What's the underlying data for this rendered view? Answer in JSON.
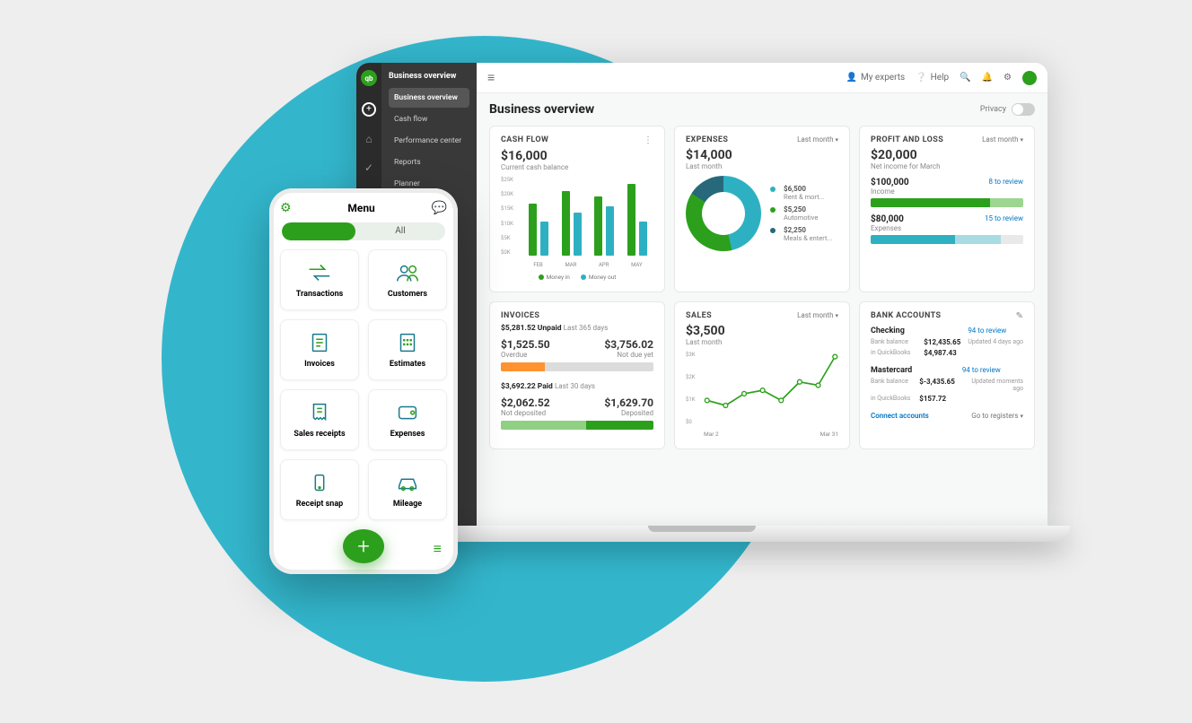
{
  "circle_color": "#33b6cc",
  "brand_green": "#2ca01c",
  "brand_teal": "#2db1c2",
  "brand_dkteal": "#27697a",
  "orange": "#ff9331",
  "dk_green": "#0f8a2f",
  "desktop": {
    "topbar": {
      "my_experts": "My experts",
      "help": "Help",
      "menu_icon": "≡"
    },
    "nav": {
      "header": "Business overview",
      "items": [
        "Business overview",
        "Cash flow",
        "Performance center",
        "Reports",
        "Planner"
      ]
    },
    "page_title": "Business overview",
    "privacy_label": "Privacy",
    "cash_flow": {
      "title": "CASH FLOW",
      "amount": "$16,000",
      "sub": "Current cash balance",
      "y_ticks": [
        "$25K",
        "$20K",
        "$15K",
        "$10K",
        "$5K",
        "$0K"
      ],
      "x_labels": [
        "FEB",
        "MAR",
        "APR",
        "MAY"
      ],
      "legend_in": "Money in",
      "legend_out": "Money out"
    },
    "expenses": {
      "title": "EXPENSES",
      "period": "Last month",
      "amount": "$14,000",
      "sub": "Last month",
      "slices": [
        {
          "amount": "$6,500",
          "label": "Rent & mort...",
          "color": "#2db1c2"
        },
        {
          "amount": "$5,250",
          "label": "Automotive",
          "color": "#2ca01c"
        },
        {
          "amount": "$2,250",
          "label": "Meals & entert...",
          "color": "#27697a"
        }
      ]
    },
    "profit_loss": {
      "title": "PROFIT AND LOSS",
      "period": "Last month",
      "amount": "$20,000",
      "sub": "Net income for March",
      "income_amt": "$100,000",
      "income_lbl": "Income",
      "income_review": "8 to review",
      "expense_amt": "$80,000",
      "expense_lbl": "Expenses",
      "expense_review": "15 to review"
    },
    "invoices": {
      "title": "INVOICES",
      "unpaid_total": "$5,281.52 Unpaid",
      "unpaid_range": "Last 365 days",
      "overdue_amt": "$1,525.50",
      "overdue_lbl": "Overdue",
      "notdue_amt": "$3,756.02",
      "notdue_lbl": "Not due yet",
      "paid_total": "$3,692.22 Paid",
      "paid_range": "Last 30 days",
      "notdep_amt": "$2,062.52",
      "notdep_lbl": "Not deposited",
      "dep_amt": "$1,629.70",
      "dep_lbl": "Deposited"
    },
    "sales": {
      "title": "SALES",
      "period": "Last month",
      "amount": "$3,500",
      "sub": "Last month",
      "y_ticks": [
        "$3K",
        "$2K",
        "$1K",
        "$0"
      ],
      "x_start": "Mar 2",
      "x_end": "Mar 31"
    },
    "bank": {
      "title": "BANK ACCOUNTS",
      "accounts": [
        {
          "name": "Checking",
          "review": "94 to review",
          "bank_bal_lbl": "Bank balance",
          "bank_bal": "$12,435.65",
          "qb_lbl": "in QuickBooks",
          "qb_bal": "$4,987.43",
          "updated": "Updated 4 days ago"
        },
        {
          "name": "Mastercard",
          "review": "94 to review",
          "bank_bal_lbl": "Bank balance",
          "bank_bal": "$-3,435.65",
          "qb_lbl": "in QuickBooks",
          "qb_bal": "$157.72",
          "updated": "Updated moments ago"
        }
      ],
      "connect": "Connect accounts",
      "registers": "Go to registers"
    }
  },
  "phone": {
    "title": "Menu",
    "chip_all": "All",
    "tiles": [
      {
        "label": "Transactions"
      },
      {
        "label": "Customers"
      },
      {
        "label": "Invoices"
      },
      {
        "label": "Estimates"
      },
      {
        "label": "Sales receipts"
      },
      {
        "label": "Expenses"
      },
      {
        "label": "Receipt snap"
      },
      {
        "label": "Mileage"
      }
    ]
  },
  "chart_data": [
    {
      "type": "bar",
      "title": "CASH FLOW",
      "categories": [
        "FEB",
        "MAR",
        "APR",
        "MAY"
      ],
      "series": [
        {
          "name": "Money in",
          "values": [
            17000,
            21000,
            19000,
            23000
          ]
        },
        {
          "name": "Money out",
          "values": [
            11000,
            14000,
            16000,
            11000
          ]
        }
      ],
      "ylim": [
        0,
        25000
      ],
      "ylabel": "",
      "xlabel": ""
    },
    {
      "type": "pie",
      "title": "EXPENSES Last month",
      "categories": [
        "Rent & mortgage",
        "Automotive",
        "Meals & entertainment"
      ],
      "values": [
        6500,
        5250,
        2250
      ]
    },
    {
      "type": "bar",
      "title": "PROFIT AND LOSS – progress",
      "categories": [
        "Income",
        "Expenses"
      ],
      "values": [
        100000,
        80000
      ],
      "annotations": {
        "Income": "8 to review",
        "Expenses": "15 to review"
      }
    },
    {
      "type": "bar",
      "title": "INVOICES Unpaid $5,281.52",
      "categories": [
        "Overdue",
        "Not due yet"
      ],
      "values": [
        1525.5,
        3756.02
      ]
    },
    {
      "type": "bar",
      "title": "INVOICES Paid $3,692.22",
      "categories": [
        "Not deposited",
        "Deposited"
      ],
      "values": [
        2062.52,
        1629.7
      ]
    },
    {
      "type": "line",
      "title": "SALES Last month",
      "x": [
        2,
        6,
        10,
        14,
        18,
        22,
        26,
        31
      ],
      "series": [
        {
          "name": "Sales",
          "values": [
            900,
            600,
            1200,
            1400,
            900,
            1800,
            1700,
            3200
          ]
        }
      ],
      "ylim": [
        0,
        3000
      ],
      "xlabel": "March",
      "ylabel": ""
    }
  ]
}
